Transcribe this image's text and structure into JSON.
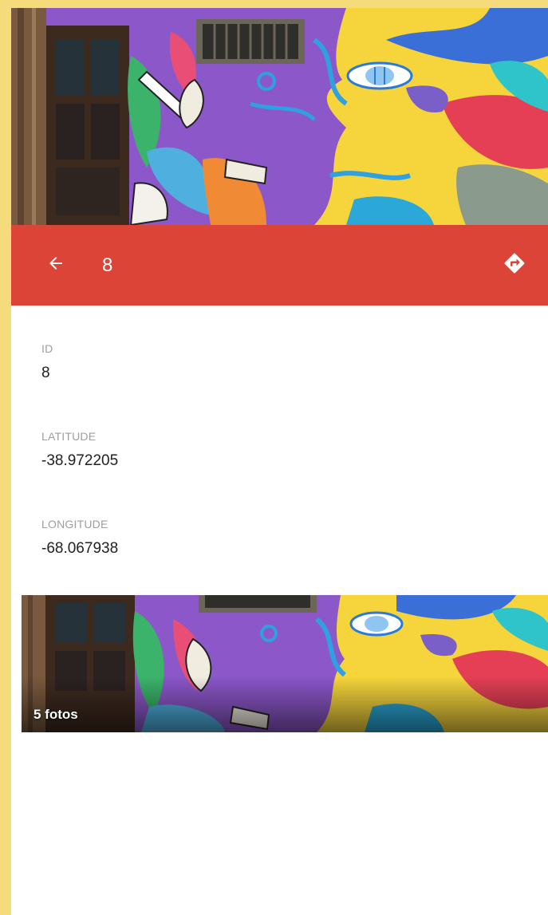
{
  "header": {
    "title": "8",
    "back_icon": "arrow-left-icon",
    "directions_icon": "directions-icon"
  },
  "fields": [
    {
      "label": "ID",
      "value": "8"
    },
    {
      "label": "LATITUDE",
      "value": "-38.972205"
    },
    {
      "label": "LONGITUDE",
      "value": "-68.067938"
    }
  ],
  "gallery": {
    "label": "5 fotos"
  },
  "colors": {
    "background": "#f5db7a",
    "appbar": "#db4437",
    "label": "#9e9e9e",
    "value": "#212121"
  }
}
